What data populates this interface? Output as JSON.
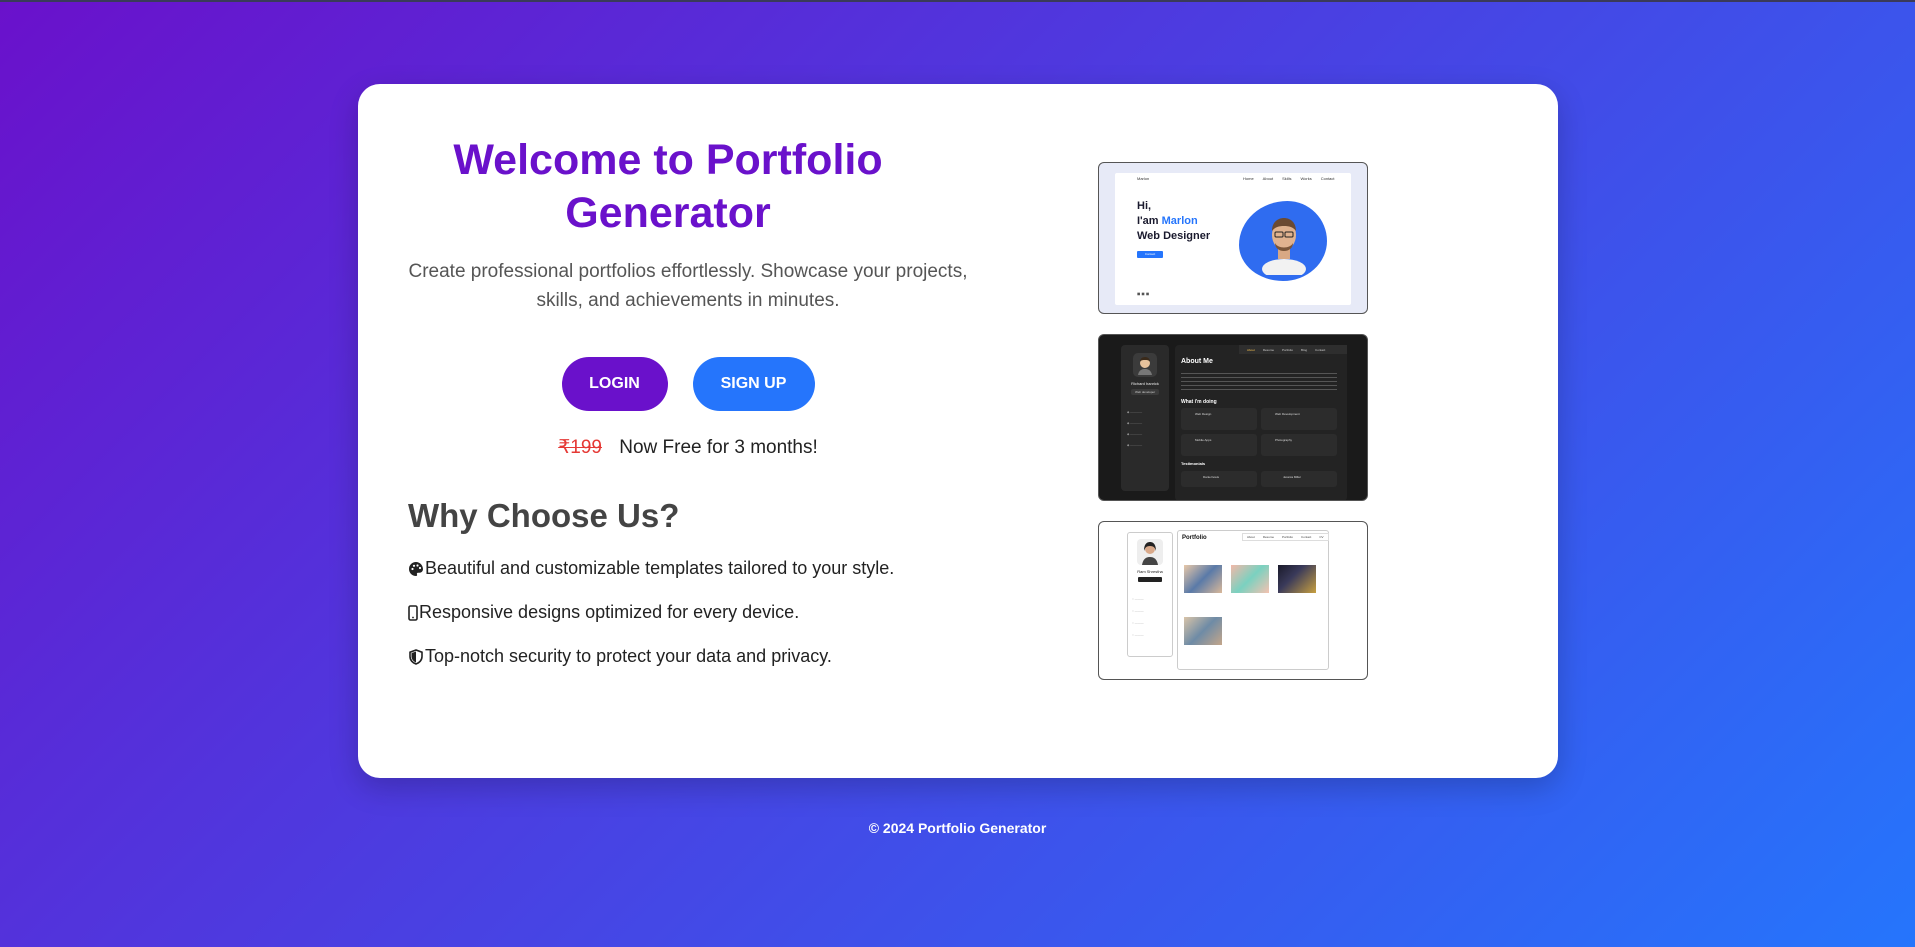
{
  "hero": {
    "title": "Welcome to Portfolio Generator",
    "subtitle": "Create professional portfolios effortlessly. Showcase your projects, skills, and achievements in minutes."
  },
  "buttons": {
    "login": "LOGIN",
    "signup": "SIGN UP"
  },
  "pricing": {
    "old_price": "₹199",
    "offer": "Now Free for 3 months!"
  },
  "why": {
    "heading": "Why Choose Us?",
    "features": [
      {
        "icon": "palette-icon",
        "text": "Beautiful and customizable templates tailored to your style."
      },
      {
        "icon": "mobile-icon",
        "text": "Responsive designs optimized for every device."
      },
      {
        "icon": "shield-icon",
        "text": "Top-notch security to protect your data and privacy."
      }
    ]
  },
  "previews": {
    "shot1": {
      "brand": "Marlon",
      "nav": [
        "Home",
        "About",
        "Skills",
        "Works",
        "Contact"
      ],
      "greeting": "Hi,",
      "intro_prefix": "I'am ",
      "name": "Marlon",
      "role": "Web Designer",
      "cta": "Contact"
    },
    "shot2": {
      "profile_name": "Richard hanrick",
      "profile_role": "Web developer",
      "nav": [
        "About",
        "Resume",
        "Portfolio",
        "Blog",
        "Contact"
      ],
      "heading": "About Me",
      "services_heading": "What i'm doing",
      "services": [
        "Web Design",
        "Web Development",
        "Mobile Apps",
        "Photography"
      ],
      "testimonials_heading": "Testimonials",
      "testimonials": [
        "Daniel lewis",
        "Jessica Miller"
      ]
    },
    "shot3": {
      "profile_name": "Ram Shrestha",
      "heading": "Portfolio",
      "nav": [
        "About",
        "Resume",
        "Portfolio",
        "Contact",
        "CV"
      ]
    }
  },
  "footer": {
    "text": "© 2024 Portfolio Generator"
  },
  "colors": {
    "primary": "#6a11cb",
    "secondary": "#2575fc",
    "strike": "#e53935"
  }
}
